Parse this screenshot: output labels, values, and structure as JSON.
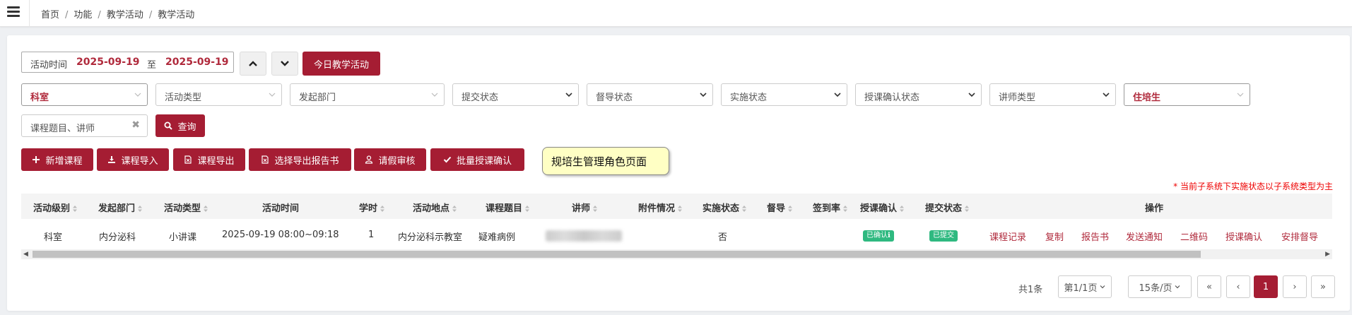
{
  "breadcrumb": [
    "首页",
    "功能",
    "教学活动",
    "教学活动"
  ],
  "toolbar": {
    "time_label": "活动时间",
    "date_from": "2025-09-19",
    "date_sep": "至",
    "date_to": "2025-09-19",
    "today_button": "今日教学活动"
  },
  "filters": {
    "department": "科室",
    "activity_type": "活动类型",
    "initiating_dept": "发起部门",
    "submit_status": "提交状态",
    "supervision_status": "督导状态",
    "implementation_status": "实施状态",
    "teaching_confirm_status": "授课确认状态",
    "lecturer_type": "讲师类型",
    "trainee_type": "住培生",
    "search_placeholder": "课程题目、讲师",
    "search_clear": "✖",
    "query_button": "查询"
  },
  "actions": {
    "add_course": "新增课程",
    "import_course": "课程导入",
    "export_course": "课程导出",
    "export_report": "选择导出报告书",
    "leave_review": "请假审核",
    "batch_confirm": "批量授课确认"
  },
  "tooltip": "规培生管理角色页面",
  "notice": "* 当前子系统下实施状态以子系统类型为主",
  "table": {
    "headers": [
      "活动级别",
      "发起部门",
      "活动类型",
      "活动时间",
      "学时",
      "活动地点",
      "课程题目",
      "讲师",
      "附件情况",
      "实施状态",
      "督导",
      "签到率",
      "授课确认",
      "提交状态",
      "操作"
    ],
    "row": {
      "level": "科室",
      "dept": "内分泌科",
      "type": "小讲课",
      "time": "2025-09-19  08:00~09:18",
      "hours": "1",
      "location": "内分泌科示教室",
      "topic": "疑难病例",
      "implemented": "否",
      "confirm_badge": "已确认ℹ",
      "submit_badge": "已提交",
      "ops": [
        "课程记录",
        "复制",
        "报告书",
        "发送通知",
        "二维码",
        "授课确认",
        "安排督导"
      ]
    }
  },
  "pager": {
    "total": "共1条",
    "page_select": "第1/1页",
    "size_select": "15条/页",
    "first": "«",
    "prev": "‹",
    "current": "1",
    "next": "›",
    "last": "»"
  },
  "colors": {
    "primary": "#a51d33",
    "badge": "#2fb980",
    "notice": "#ee0000"
  }
}
